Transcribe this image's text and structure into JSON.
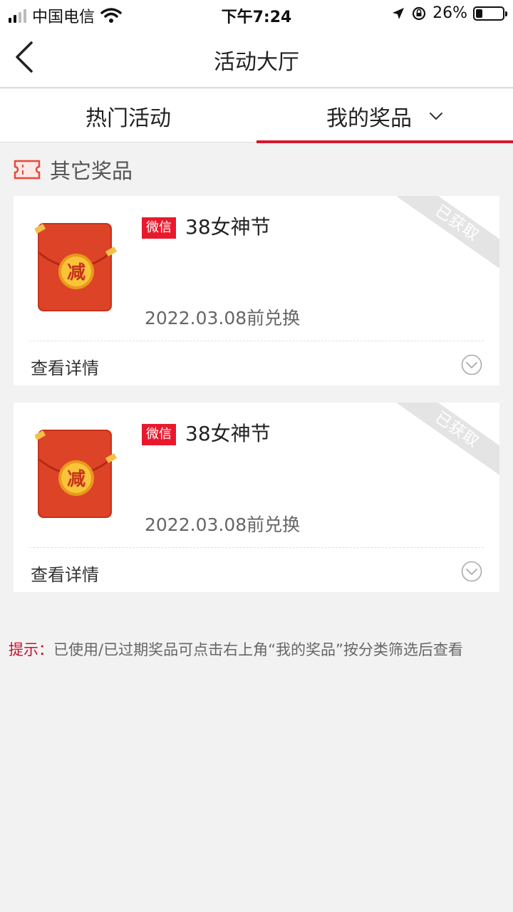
{
  "status_bar": {
    "carrier": "中国电信",
    "time": "下午7:24",
    "battery_text": "26%",
    "battery_level": 0.26
  },
  "nav": {
    "title": "活动大厅"
  },
  "tabs": [
    {
      "label": "热门活动",
      "active": false
    },
    {
      "label": "我的奖品",
      "active": true
    }
  ],
  "section": {
    "title": "其它奖品"
  },
  "prizes": [
    {
      "tag": "微信",
      "title": "38女神节",
      "expire": "2022.03.08前兑换",
      "status": "已获取",
      "details_label": "查看详情",
      "envelope_char": "减"
    },
    {
      "tag": "微信",
      "title": "38女神节",
      "expire": "2022.03.08前兑换",
      "status": "已获取",
      "details_label": "查看详情",
      "envelope_char": "减"
    }
  ],
  "tip": {
    "label": "提示：",
    "text": "已使用/已过期奖品可点击右上角“我的奖品”按分类筛选后查看"
  },
  "colors": {
    "accent": "#d6172f",
    "tag_bg": "#e8192d",
    "envelope": "#d83a22",
    "coin": "#f5b52b"
  }
}
